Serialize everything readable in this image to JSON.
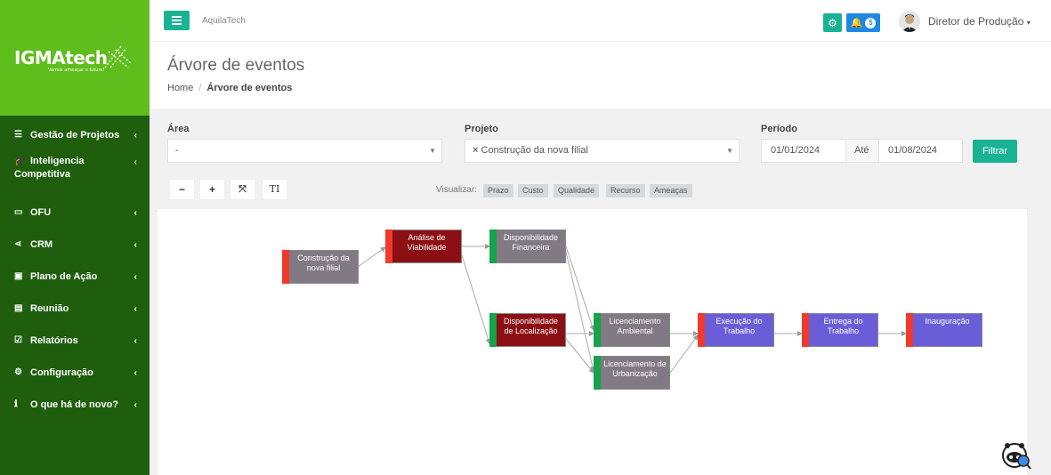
{
  "sidebar": {
    "logo": "IGMAtech",
    "logo_tag": "Vamos ameaçar o futuro!",
    "items": [
      {
        "label": "Gestão de Projetos",
        "icon": "list-icon"
      },
      {
        "label": "Inteligencia Competitiva",
        "icon": "graduation-cap-icon"
      },
      {
        "label": "OFU",
        "icon": "card-icon"
      },
      {
        "label": "CRM",
        "icon": "share-icon"
      },
      {
        "label": "Plano de Ação",
        "icon": "calendar-check-icon"
      },
      {
        "label": "Reunião",
        "icon": "table-icon"
      },
      {
        "label": "Relatórios",
        "icon": "checkbox-icon"
      },
      {
        "label": "Configuração",
        "icon": "gear-icon"
      },
      {
        "label": "O que há de novo?",
        "icon": "info-icon"
      }
    ]
  },
  "topbar": {
    "brand": "AquilaTech",
    "notifications": "5",
    "user": "Diretor de Produção"
  },
  "page": {
    "title": "Árvore de eventos",
    "breadcrumb_home": "Home",
    "breadcrumb_current": "Árvore de eventos"
  },
  "filters": {
    "area_label": "Área",
    "area_value": "-",
    "projeto_label": "Projeto",
    "projeto_value": "Construção da nova filial",
    "periodo_label": "Período",
    "date_from": "01/01/2024",
    "ate": "Até",
    "date_to": "01/08/2024",
    "filter_button": "Filtrar"
  },
  "toolbar": {
    "zoom_out": "−",
    "zoom_in": "+",
    "fit": "⤧",
    "text": "TI",
    "visualizar": "Visualizar:",
    "tags": [
      "Prazo",
      "Custo",
      "Qualidade",
      "Recurso",
      "Ameaças"
    ]
  },
  "nodes": [
    {
      "label": "Construção da nova filial",
      "color": "gray",
      "strip": "red"
    },
    {
      "label": "Análise de Viabilidade",
      "color": "dark",
      "strip": "red"
    },
    {
      "label": "Disponibilidade Financeira",
      "color": "gray",
      "strip": "green"
    },
    {
      "label": "Disponibilidade de Localização",
      "color": "dark",
      "strip": "green"
    },
    {
      "label": "Licenciamento Ambiental",
      "color": "gray",
      "strip": "green"
    },
    {
      "label": "Licenciamento de Urbanização",
      "color": "gray",
      "strip": "green"
    },
    {
      "label": "Execução do Trabalho",
      "color": "blue",
      "strip": "red"
    },
    {
      "label": "Entrega do Trabalho",
      "color": "blue",
      "strip": "red"
    },
    {
      "label": "Inauguração",
      "color": "blue",
      "strip": "red"
    }
  ]
}
